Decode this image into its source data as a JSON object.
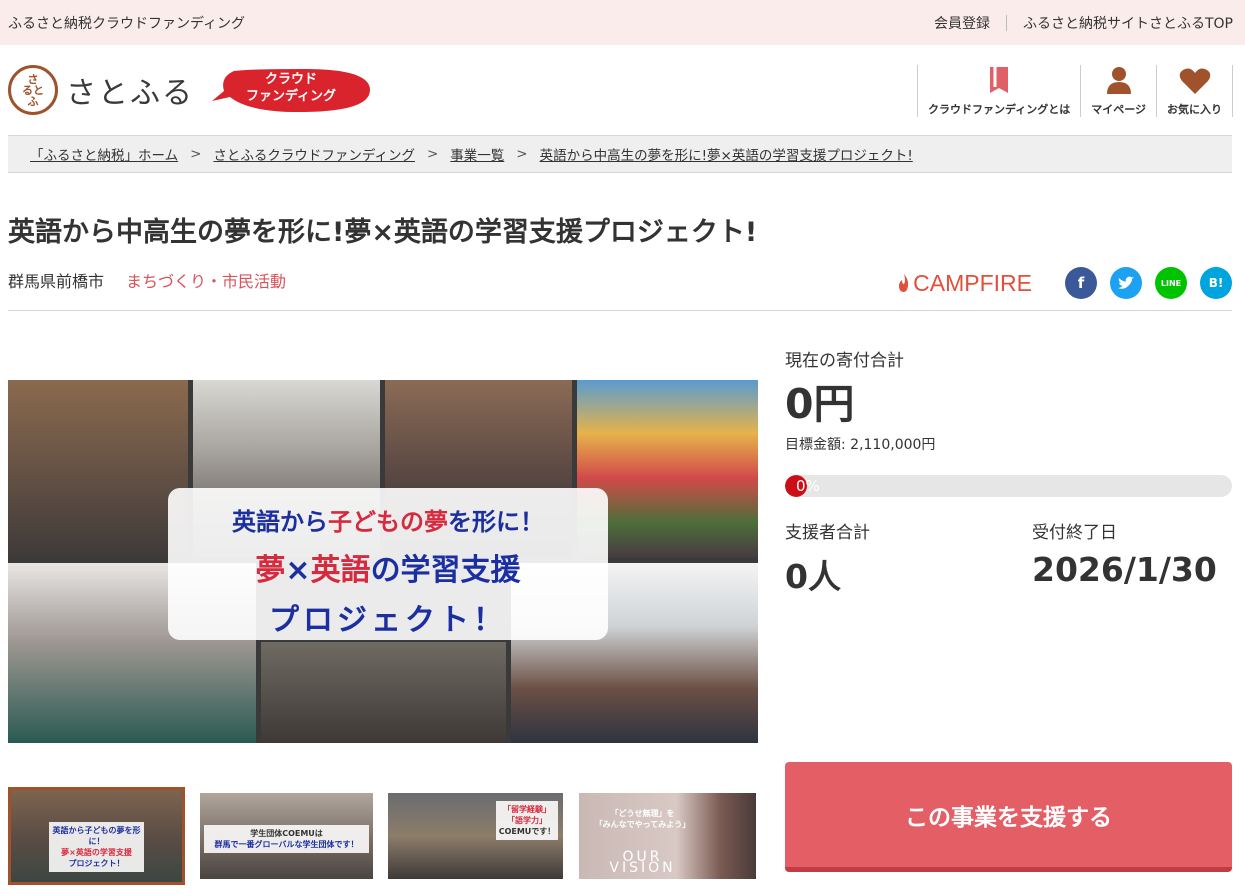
{
  "topbar": {
    "left_text": "ふるさと納税クラウドファンディング",
    "links": [
      "会員登録",
      "ふるさと納税サイトさとふるTOP"
    ]
  },
  "header": {
    "logo_text": "さとふる",
    "logo_mark": "さ る と ふ",
    "badge_line1": "クラウド",
    "badge_line2": "ファンディング",
    "nav": [
      {
        "label": "クラウドファンディングとは",
        "icon": "book-icon"
      },
      {
        "label": "マイページ",
        "icon": "person-icon"
      },
      {
        "label": "お気に入り",
        "icon": "heart-icon"
      }
    ]
  },
  "breadcrumb": [
    "「ふるさと納税」ホーム",
    "さとふるクラウドファンディング",
    "事業一覧",
    "英語から中高生の夢を形に!夢×英語の学習支援プロジェクト!"
  ],
  "breadcrumb_sep": ">",
  "project": {
    "title": "英語から中高生の夢を形に!夢×英語の学習支援プロジェクト!",
    "city": "群馬県前橋市",
    "category": "まちづくり・市民活動"
  },
  "share": {
    "partner": "CAMPFIRE",
    "sns": [
      {
        "name": "facebook-icon",
        "glyph": "f",
        "color": "#3b5998"
      },
      {
        "name": "twitter-icon",
        "glyph": "t",
        "color": "#1da1f2"
      },
      {
        "name": "line-icon",
        "glyph": "LINE",
        "color": "#00c300"
      },
      {
        "name": "hatena-icon",
        "glyph": "B!",
        "color": "#00a4de"
      }
    ]
  },
  "main_image": {
    "overlay_line1_a": "英語から",
    "overlay_line1_b": "子どもの夢",
    "overlay_line1_c": "を形に！",
    "overlay_line2_a": "夢",
    "overlay_line2_b": "×",
    "overlay_line2_c": "英語",
    "overlay_line2_d": "の学習支援",
    "overlay_line3": "プロジェクト！"
  },
  "thumbnails": [
    {
      "line1": "英語から子どもの夢を形に！",
      "line2": "夢×英語の学習支援",
      "line3": "プロジェクト！"
    },
    {
      "line1": "学生団体COEMUは",
      "line2": "群馬で一番グローバルな学生団体です！",
      "line3": ""
    },
    {
      "line1": "「留学経験」",
      "line2": "「語学力」",
      "line3": "COEMUです！"
    },
    {
      "line1": "「どうせ無理」を",
      "line2": "「みんなでやってみよう」",
      "line3": "OUR VISION"
    }
  ],
  "stats": {
    "current_label": "現在の寄付合計",
    "current_amount": "0円",
    "target_text": "目標金額: 2,110,000円",
    "progress_text": "0%",
    "progress_fraction": 0,
    "supporters_label": "支援者合計",
    "supporters_value": "0人",
    "deadline_label": "受付終了日",
    "deadline_value": "2026/1/30"
  },
  "cta": {
    "label": "この事業を支援する"
  },
  "colors": {
    "accent": "#e45e66",
    "topbar_bg": "#fbecec",
    "category": "#d9535b",
    "brand_brown": "#a0522d"
  }
}
